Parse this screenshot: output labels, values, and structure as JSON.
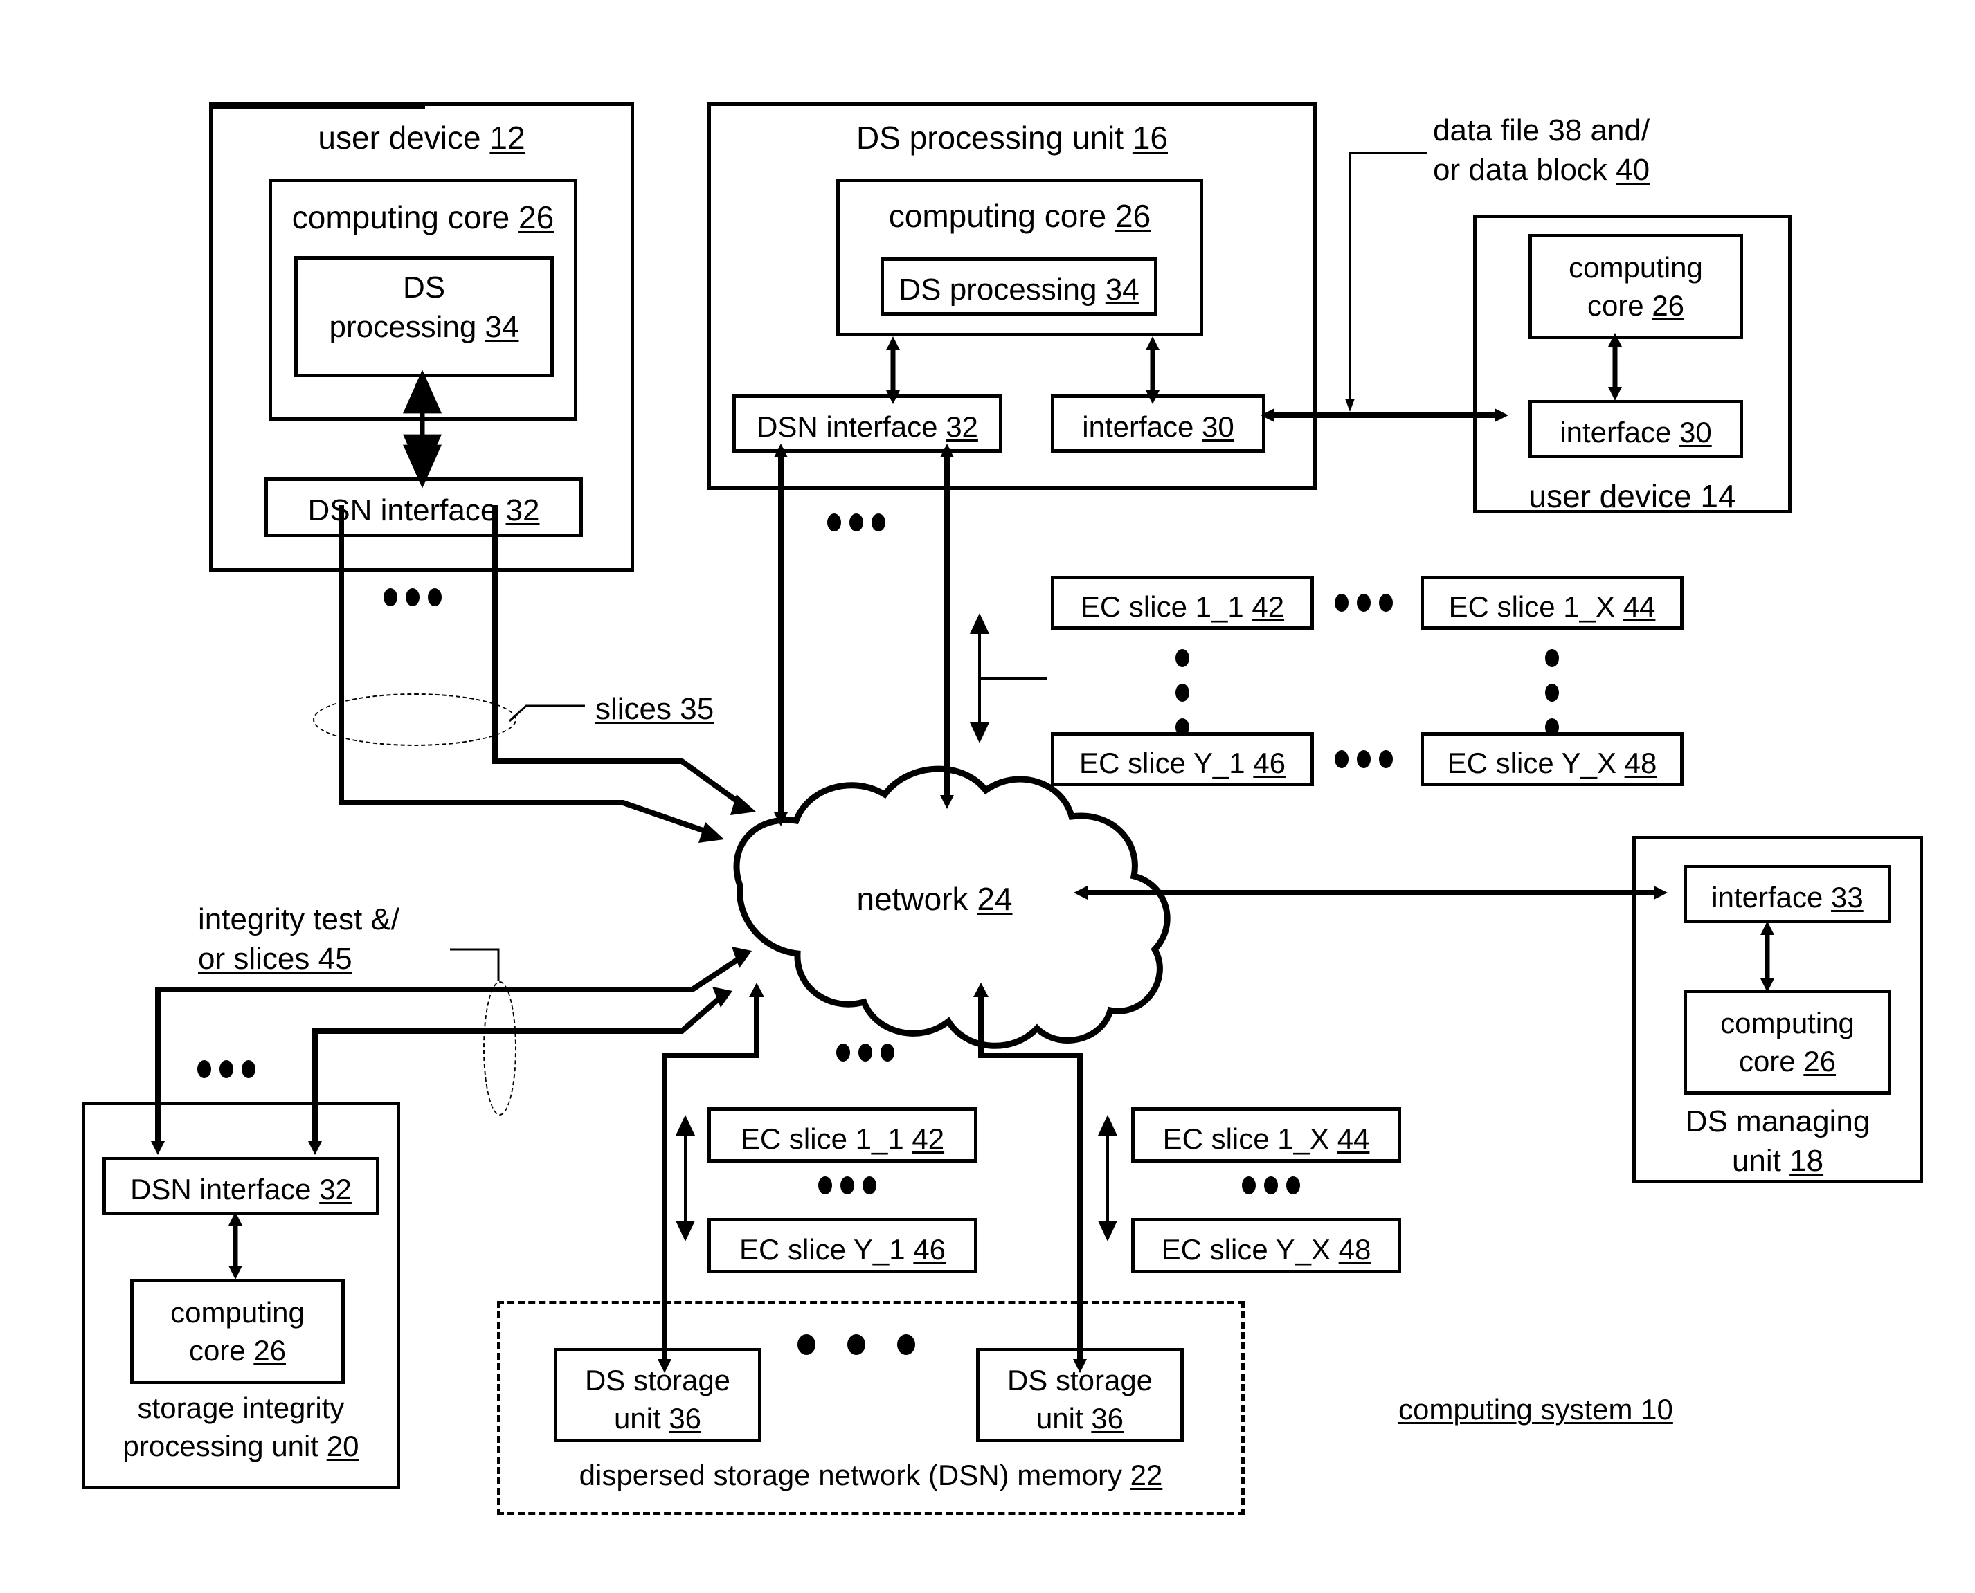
{
  "figure": {
    "title": "computing system 10",
    "title_underlined": true
  },
  "user_device_12": {
    "title": "user device 12",
    "computing_core": "computing core 26",
    "ds_processing": "DS processing 34",
    "ds_processing_line1": "DS",
    "ds_processing_line2": "processing 34",
    "dsn_interface": "DSN interface 32"
  },
  "ds_processing_unit_16": {
    "title": "DS processing unit 16",
    "computing_core": "computing core 26",
    "ds_processing": "DS processing 34",
    "dsn_interface": "DSN interface 32",
    "interface": "interface 30"
  },
  "user_device_14": {
    "title": "user device 14",
    "computing_core_line1": "computing",
    "computing_core_line2": "core 26",
    "interface": "interface 30"
  },
  "ds_managing_unit_18": {
    "title_line1": "DS managing",
    "title_line2": "unit 18",
    "interface": "interface 33",
    "computing_core_line1": "computing",
    "computing_core_line2": "core 26"
  },
  "storage_integrity_unit_20": {
    "title_line1": "storage integrity",
    "title_line2": "processing unit 20",
    "dsn_interface": "DSN interface 32",
    "computing_core_line1": "computing",
    "computing_core_line2": "core 26"
  },
  "dsn_memory_22": {
    "title": "dispersed storage network (DSN) memory 22",
    "storage_units": [
      {
        "line1": "DS storage",
        "line2": "unit 36"
      },
      {
        "line1": "DS storage",
        "line2": "unit 36"
      }
    ]
  },
  "network": {
    "label": "network 24"
  },
  "annotations": {
    "data_file_line1": "data file 38 and/",
    "data_file_line2": "or data block 40",
    "slices_35": "slices 35",
    "integrity_line1": "integrity test &/",
    "integrity_line2": "or slices 45"
  },
  "ec_slices_top": [
    {
      "label": "EC slice 1_1 42"
    },
    {
      "label": "EC slice 1_X 44"
    },
    {
      "label": "EC slice Y_1 46"
    },
    {
      "label": "EC slice Y_X 48"
    }
  ],
  "ec_slices_bottom": [
    {
      "label": "EC slice 1_1 42"
    },
    {
      "label": "EC slice 1_X 44"
    },
    {
      "label": "EC slice Y_1 46"
    },
    {
      "label": "EC slice Y_X 48"
    }
  ],
  "colors": {
    "ink": "#000000",
    "paper": "#ffffff"
  }
}
